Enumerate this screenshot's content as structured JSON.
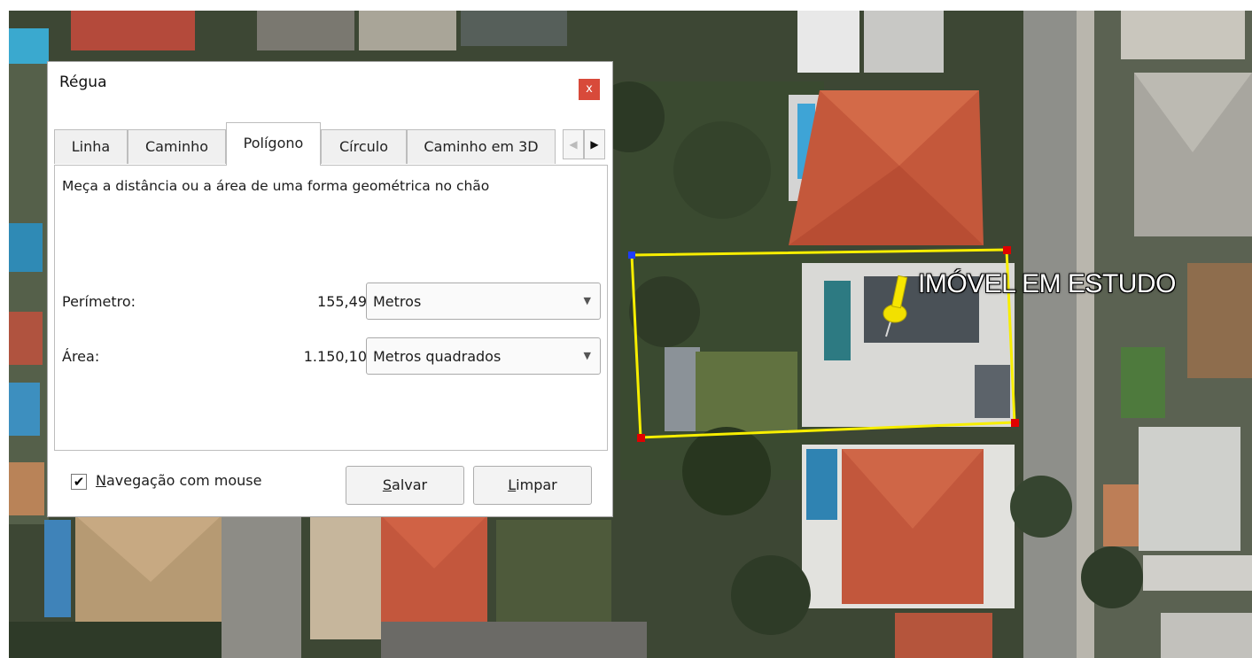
{
  "map": {
    "label": "IMÓVEL EM ESTUDO",
    "colors": {
      "roof": "#c55a3a",
      "polygon": "#ffee00",
      "vertex_red": "#e00000",
      "vertex_blue": "#0030ff",
      "grass": "#55603f"
    }
  },
  "dialog": {
    "title": "Régua",
    "close_label": "x",
    "tabs": [
      "Linha",
      "Caminho",
      "Polígono",
      "Círculo",
      "Caminho em 3D"
    ],
    "active_tab": "Polígono",
    "description": "Meça a distância ou a área de uma forma geométrica no chão",
    "perimeter": {
      "label": "Perímetro:",
      "value": "155,49",
      "unit": "Metros"
    },
    "area": {
      "label": "Área:",
      "value": "1.150,10",
      "unit": "Metros quadrados"
    },
    "mouse_nav": {
      "label_first": "N",
      "label_rest": "avegação com mouse",
      "checked": true
    },
    "save_first": "S",
    "save_rest": "alvar",
    "clear_first": "L",
    "clear_rest": "impar"
  }
}
